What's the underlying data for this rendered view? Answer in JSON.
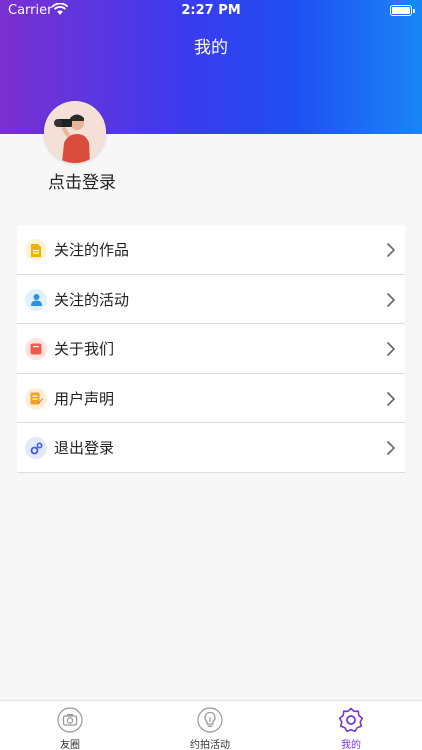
{
  "status_bar": {
    "carrier": "Carrier",
    "time": "2:27 PM"
  },
  "header": {
    "title": "我的"
  },
  "profile": {
    "login_label": "点击登录"
  },
  "menu": {
    "items": [
      {
        "label": "关注的作品",
        "icon": "document-icon",
        "icon_color": "#f0b400"
      },
      {
        "label": "关注的活动",
        "icon": "person-icon",
        "icon_color": "#2b8fe3"
      },
      {
        "label": "关于我们",
        "icon": "info-card-icon",
        "icon_color": "#f05a4a"
      },
      {
        "label": "用户声明",
        "icon": "statement-icon",
        "icon_color": "#f0a020"
      },
      {
        "label": "退出登录",
        "icon": "gears-icon",
        "icon_color": "#3f5fc8"
      }
    ]
  },
  "tabbar": {
    "tabs": [
      {
        "label": "友圈",
        "icon": "camera-icon",
        "active": false
      },
      {
        "label": "约拍活动",
        "icon": "bulb-icon",
        "active": false
      },
      {
        "label": "我的",
        "icon": "settings-icon",
        "active": true
      }
    ],
    "active_color": "#7a35d6"
  }
}
